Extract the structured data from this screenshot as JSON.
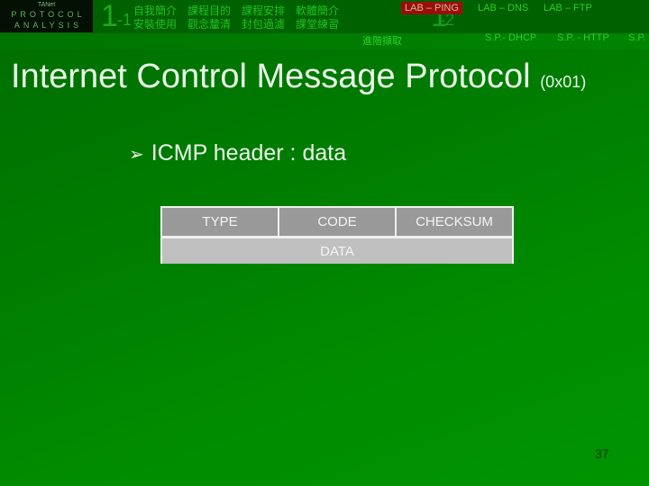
{
  "header": {
    "logo": {
      "small": "TANet",
      "line1": "PROTOCOL",
      "line2": "ANALYSIS"
    },
    "section1": {
      "number": "1",
      "sub": "-1",
      "row1": [
        "自我簡介",
        "課程目的",
        "課程安排",
        "軟體簡介"
      ],
      "row2": [
        "安裝使用",
        "觀念釐清",
        "封包過濾",
        "課堂練習"
      ]
    },
    "section2": {
      "number": "1",
      "sub": "-2",
      "labs": [
        "LAB – PING",
        "LAB – DNS",
        "LAB – FTP"
      ],
      "active_lab": "LAB – PING",
      "advanced": "進階擷取",
      "sp_items": [
        "S.P.- DHCP",
        "S.P. - HTTP",
        "S.P."
      ]
    },
    "colors": {
      "active_bg": "#9c0e0e",
      "nav_text": "#2ecc2e"
    }
  },
  "slide": {
    "title": "Internet Control Message Protocol",
    "title_code": "(0x01)",
    "bullet_arrow": "➢",
    "bullet_text": "ICMP header : data",
    "table": {
      "row1": [
        "TYPE",
        "CODE",
        "CHECKSUM"
      ],
      "row2": "DATA"
    },
    "page_number": "37"
  }
}
